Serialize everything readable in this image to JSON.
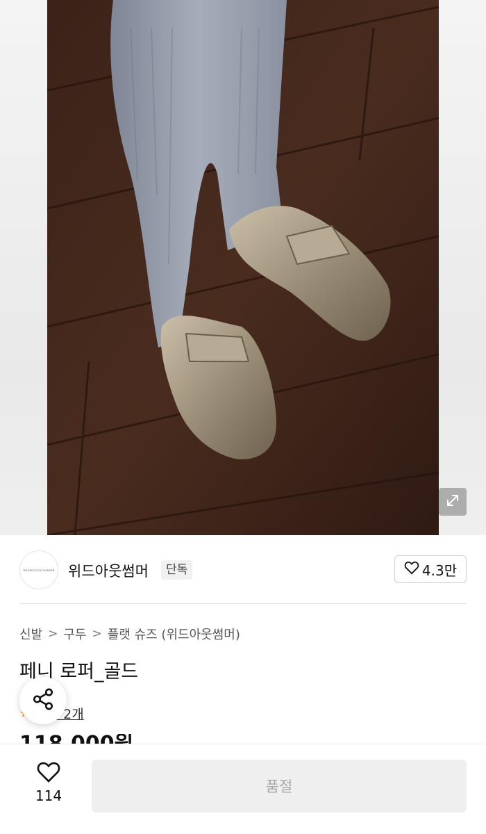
{
  "seller": {
    "logo_text": "WIDEOUTSUMMER",
    "name": "위드아웃썸머",
    "badge": "단독",
    "likes": "4.3만"
  },
  "breadcrumb": [
    "신발",
    "구두",
    "플랫 슈즈 (위드아웃썸머)"
  ],
  "product": {
    "title": "페니 로퍼_골드",
    "review_label": "후기 2개",
    "price": "118,000원"
  },
  "bottom_bar": {
    "wish_count": "114",
    "buy_label": "품절"
  },
  "icons": {
    "expand": "expand-icon",
    "heart": "heart-icon",
    "share": "share-icon",
    "star": "star-icon"
  },
  "colors": {
    "star": "#f5a623",
    "sold_out_bg": "#efefef",
    "sold_out_text": "#a5a5a5"
  }
}
